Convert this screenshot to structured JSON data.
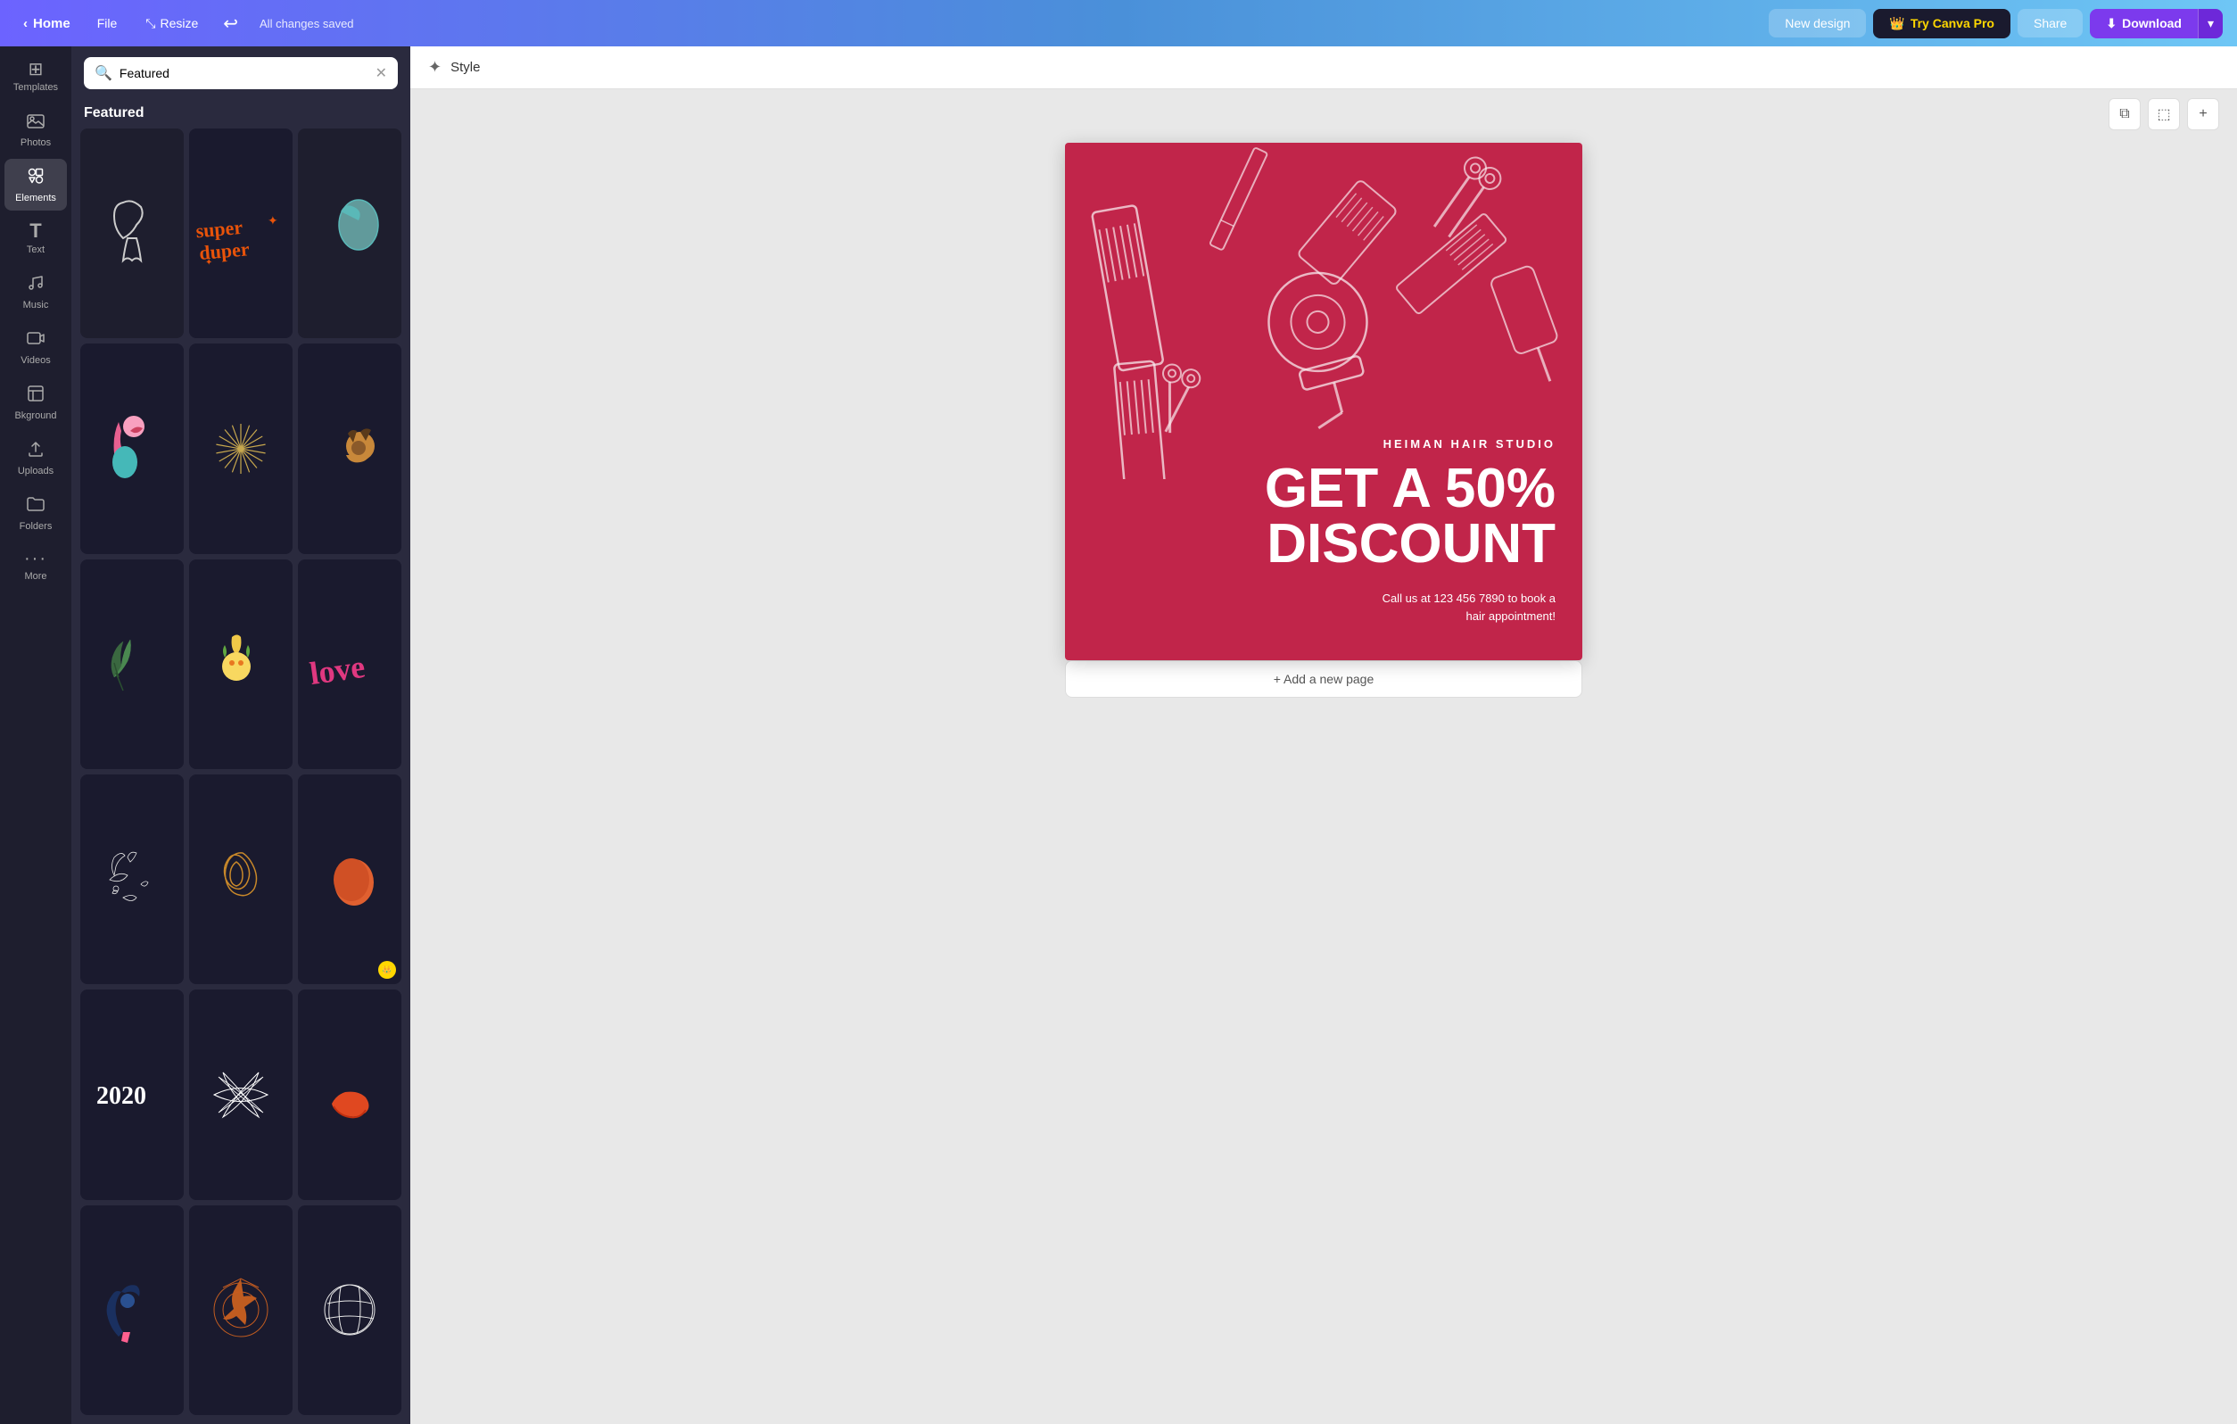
{
  "nav": {
    "home_label": "Home",
    "file_label": "File",
    "resize_label": "Resize",
    "saved_label": "All changes saved",
    "new_design_label": "New design",
    "try_pro_label": "Try Canva Pro",
    "share_label": "Share",
    "download_label": "Download"
  },
  "sidebar": {
    "items": [
      {
        "id": "templates",
        "label": "Templates",
        "icon": "⊞"
      },
      {
        "id": "photos",
        "label": "Photos",
        "icon": "🖼"
      },
      {
        "id": "elements",
        "label": "Elements",
        "icon": "✦"
      },
      {
        "id": "text",
        "label": "Text",
        "icon": "T"
      },
      {
        "id": "music",
        "label": "Music",
        "icon": "♪"
      },
      {
        "id": "videos",
        "label": "Videos",
        "icon": "▶"
      },
      {
        "id": "background",
        "label": "Bkground",
        "icon": "◫"
      },
      {
        "id": "uploads",
        "label": "Uploads",
        "icon": "↑"
      },
      {
        "id": "folders",
        "label": "Folders",
        "icon": "📁"
      },
      {
        "id": "more",
        "label": "More",
        "icon": "···"
      }
    ]
  },
  "search": {
    "value": "Featured",
    "placeholder": "Search elements"
  },
  "panel": {
    "featured_label": "Featured"
  },
  "style_bar": {
    "label": "Style"
  },
  "design": {
    "studio_name": "HEIMAN HAIR STUDIO",
    "headline": "GET A 50%\nDISCOUNT",
    "subtext": "Call us at 123 456 7890 to book a\nhair appointment!",
    "bg_color": "#c1254a"
  },
  "canvas": {
    "add_page_label": "+ Add a new page"
  }
}
